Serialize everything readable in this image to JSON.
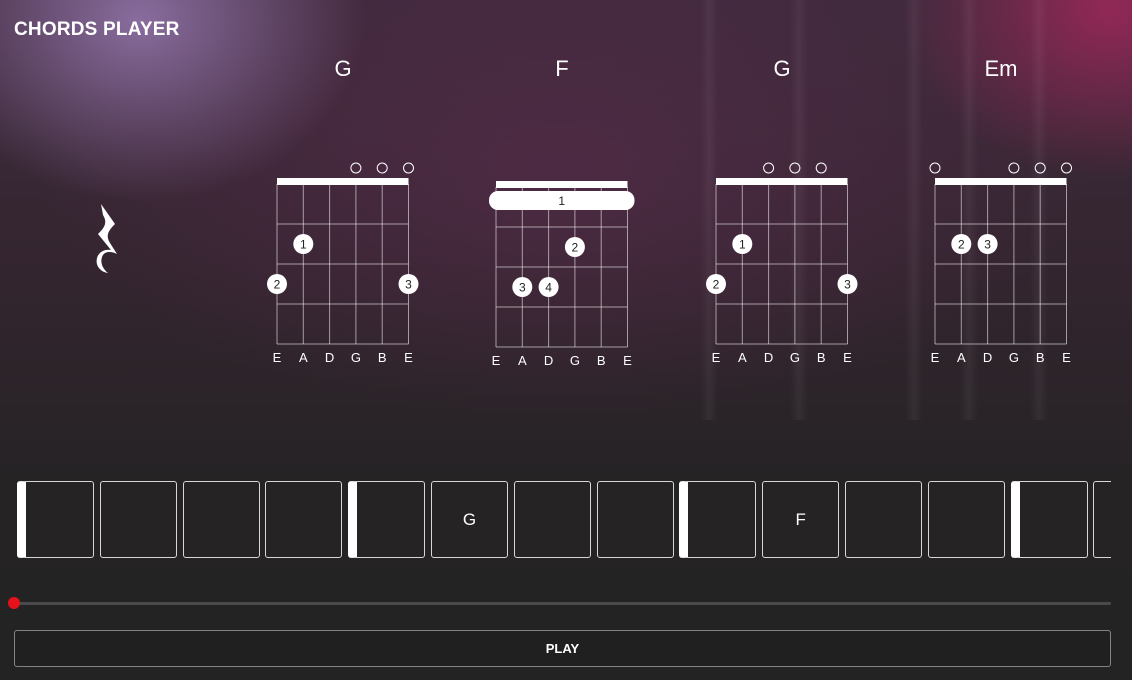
{
  "app": {
    "title": "CHORDS PLAYER"
  },
  "colors": {
    "accent": "#ffffff",
    "playhead": "#e3121b",
    "background": "#232323"
  },
  "rest_icon": "quarter-rest-icon",
  "chords": [
    {
      "name": "G",
      "strings": [
        "E",
        "A",
        "D",
        "G",
        "B",
        "E"
      ],
      "open": [
        3,
        4,
        5
      ],
      "barre": null,
      "fingers": [
        {
          "string": 1,
          "fret": 2,
          "finger": "1"
        },
        {
          "string": 0,
          "fret": 3,
          "finger": "2"
        },
        {
          "string": 5,
          "fret": 3,
          "finger": "3"
        }
      ]
    },
    {
      "name": "F",
      "strings": [
        "E",
        "A",
        "D",
        "G",
        "B",
        "E"
      ],
      "open": [],
      "barre": {
        "fret": 1,
        "finger": "1"
      },
      "fingers": [
        {
          "string": 3,
          "fret": 2,
          "finger": "2"
        },
        {
          "string": 1,
          "fret": 3,
          "finger": "3"
        },
        {
          "string": 2,
          "fret": 3,
          "finger": "4"
        }
      ]
    },
    {
      "name": "G",
      "strings": [
        "E",
        "A",
        "D",
        "G",
        "B",
        "E"
      ],
      "open": [
        2,
        3,
        4
      ],
      "barre": null,
      "fingers": [
        {
          "string": 1,
          "fret": 2,
          "finger": "1"
        },
        {
          "string": 0,
          "fret": 3,
          "finger": "2"
        },
        {
          "string": 5,
          "fret": 3,
          "finger": "3"
        }
      ]
    },
    {
      "name": "Em",
      "strings": [
        "E",
        "A",
        "D",
        "G",
        "B",
        "E"
      ],
      "open": [
        0,
        3,
        4,
        5
      ],
      "barre": null,
      "fingers": [
        {
          "string": 1,
          "fret": 2,
          "finger": "2"
        },
        {
          "string": 2,
          "fret": 2,
          "finger": "3"
        }
      ]
    }
  ],
  "timeline": {
    "beats": [
      {
        "label": "",
        "bar_start": true
      },
      {
        "label": "",
        "bar_start": false
      },
      {
        "label": "",
        "bar_start": false
      },
      {
        "label": "",
        "bar_start": false
      },
      {
        "label": "",
        "bar_start": true
      },
      {
        "label": "G",
        "bar_start": false
      },
      {
        "label": "",
        "bar_start": false
      },
      {
        "label": "",
        "bar_start": false
      },
      {
        "label": "",
        "bar_start": true
      },
      {
        "label": "F",
        "bar_start": false
      },
      {
        "label": "",
        "bar_start": false
      },
      {
        "label": "",
        "bar_start": false
      },
      {
        "label": "",
        "bar_start": true
      },
      {
        "label": "",
        "bar_start": false
      }
    ]
  },
  "progress": {
    "value": 0
  },
  "controls": {
    "play_label": "PLAY"
  }
}
